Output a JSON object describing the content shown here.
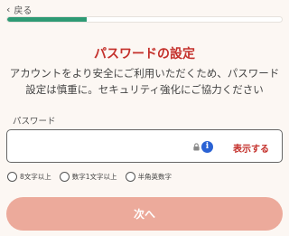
{
  "header": {
    "back_label": "戻る"
  },
  "progress": {
    "value": 0.29,
    "color": "#2e9a74"
  },
  "title": "パスワードの設定",
  "description": {
    "line1": "アカウントをより安全にご利用いただくため、パスワード",
    "line2": "設定は慎重に。セキュリティ強化にご協力ください"
  },
  "password": {
    "label": "パスワード",
    "value": "",
    "placeholder": "",
    "show_label": "表示する",
    "info_icon_text": "i"
  },
  "requirements": [
    {
      "label": "8文字以上",
      "checked": false
    },
    {
      "label": "数字1文字以上",
      "checked": false
    },
    {
      "label": "半角英数字",
      "checked": false
    }
  ],
  "next_button": {
    "label": "次へ",
    "color": "#ecaa9b"
  },
  "colors": {
    "accent": "#c4302b",
    "background": "#fcf7f3"
  }
}
